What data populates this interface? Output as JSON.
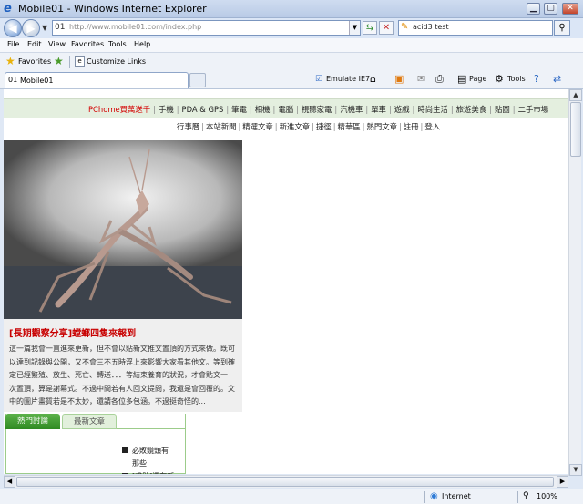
{
  "window": {
    "title": "Mobile01 - Windows Internet Explorer"
  },
  "address": {
    "url": "http://www.mobile01.com/index.php"
  },
  "search": {
    "query": "acid3 test"
  },
  "menu": [
    "File",
    "Edit",
    "View",
    "Favorites",
    "Tools",
    "Help"
  ],
  "favorites_bar": {
    "favorites_label": "Favorites",
    "customize_label": "Customize Links"
  },
  "tab": {
    "title": "Mobile01"
  },
  "commands": {
    "emulate": "Emulate IE7",
    "page": "Page",
    "tools": "Tools"
  },
  "site_nav": {
    "items": [
      "PChome買萬送千",
      "手機",
      "PDA & GPS",
      "筆電",
      "相機",
      "電腦",
      "視聽家電",
      "汽機車",
      "單車",
      "遊戲",
      "時尚生活",
      "旅遊美食",
      "貼圖",
      "二手市場"
    ],
    "sub_items": [
      "行事曆",
      "本站新聞",
      "精選文章",
      "新進文章",
      "捷徑",
      "精華區",
      "熱門文章",
      "註冊",
      "登入"
    ]
  },
  "feature": {
    "title": "[長期觀察分享]螳螂四隻來報到",
    "lines": [
      "這一篇我會一直進來更新，但不會以貼新文推文置頂的方式來做。既可",
      "以達到記錄與公開，又不會三不五時浮上來影響大家看其他文。等到確",
      "定已經繁殖、放生、死亡、轉送．．．等結束養育的狀況，才會貼文一",
      "次置頂，算是謝幕式。不過中間若有人回文提問，我還是會回覆的。文",
      "中的圖片畫質若是不太妙，還請各位多包涵。不過挺奇怪的..."
    ]
  },
  "article_tabs": {
    "active": "熱門討論",
    "inactive": "最新文章"
  },
  "list_items": [
    {
      "lines": [
        "必敗鏡頭有",
        "那些"
      ]
    },
    {
      "lines": [
        "[求助]還有新"
      ]
    }
  ],
  "status": {
    "zone": "Internet",
    "zoom": "100%"
  }
}
